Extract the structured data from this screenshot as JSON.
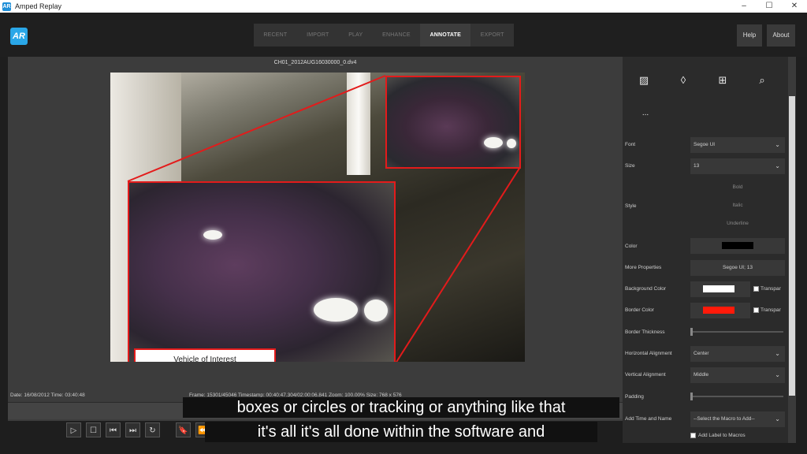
{
  "window": {
    "title": "Amped Replay",
    "minimize": "–",
    "maximize": "☐",
    "close": "✕"
  },
  "logo": "AR",
  "tabs": [
    {
      "label": "RECENT",
      "active": false
    },
    {
      "label": "IMPORT",
      "active": false
    },
    {
      "label": "PLAY",
      "active": false
    },
    {
      "label": "ENHANCE",
      "active": false
    },
    {
      "label": "ANNOTATE",
      "active": true
    },
    {
      "label": "EXPORT",
      "active": false
    }
  ],
  "header_buttons": {
    "help": "Help",
    "about": "About"
  },
  "viewer": {
    "filename": "CH01_2012AUG16030000_0.dv4",
    "annotation_label": "Vehicle of Interest",
    "status_left": "Date: 16/08/2012 Time: 03:40:48",
    "status_center": "Frame: 15301/45046  Timestamp: 00:40:47.304/02:00:06.841  Zoom: 100.00%  Size: 768 x 576"
  },
  "playback_icons": [
    "play-icon",
    "stop-icon",
    "first-frame-icon",
    "last-frame-icon",
    "loop-icon",
    "bookmark-icon",
    "rewind-icon"
  ],
  "playback_glyphs": [
    "▷",
    "☐",
    "⏮",
    "⏭",
    "↻",
    "🔖",
    "⏪"
  ],
  "panel": {
    "tool_icons": [
      "image-icon",
      "drop-icon",
      "add-image-icon",
      "magnifier-icon"
    ],
    "tool_glyphs": [
      "▨",
      "◊",
      "⊞",
      "⌕"
    ],
    "more": "...",
    "font": {
      "label": "Font",
      "value": "Segoe UI"
    },
    "size": {
      "label": "Size",
      "value": "13"
    },
    "style": {
      "label": "Style",
      "bold": "Bold",
      "italic": "Italic",
      "underline": "Underline"
    },
    "color": {
      "label": "Color",
      "value": "#000000"
    },
    "more_properties": {
      "label": "More Properties",
      "value": "Segoe UI; 13"
    },
    "background_color": {
      "label": "Background Color",
      "value": "#ffffff",
      "transparent": "Transpar"
    },
    "border_color": {
      "label": "Border Color",
      "value": "#ff1a0a",
      "transparent": "Transpar"
    },
    "border_thickness": {
      "label": "Border Thickness"
    },
    "horizontal_alignment": {
      "label": "Horizontal Alignment",
      "value": "Center"
    },
    "vertical_alignment": {
      "label": "Vertical Alignment",
      "value": "Middle"
    },
    "padding": {
      "label": "Padding"
    },
    "add_time_name": {
      "label": "Add Time and Name",
      "value": "--Select the Macro to Add--"
    },
    "add_label_macros": "Add Label to Macros"
  },
  "subtitles": {
    "line1": "boxes or circles or tracking or anything like that",
    "line2": "it's all it's all done within the software and"
  },
  "colors": {
    "accent": "#e31b1b",
    "logo": "#2aa7e8"
  }
}
